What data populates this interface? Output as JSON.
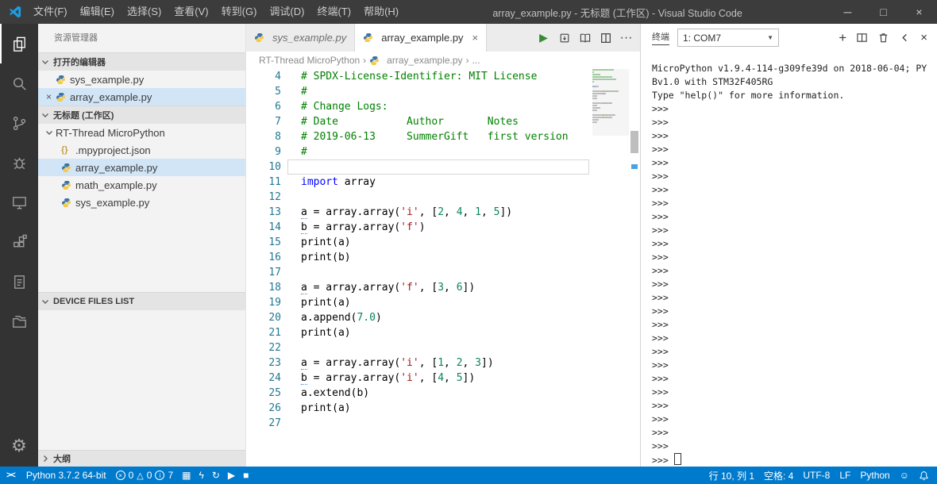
{
  "title_bar": {
    "menus": [
      "文件(F)",
      "编辑(E)",
      "选择(S)",
      "查看(V)",
      "转到(G)",
      "调试(D)",
      "终端(T)",
      "帮助(H)"
    ],
    "title": "array_example.py - 无标题 (工作区) - Visual Studio Code"
  },
  "icons": {
    "minimize": "─",
    "maximize": "□",
    "close": "×",
    "tab_close": "×",
    "dropdown_arrow": "▼",
    "more": "···",
    "plus": "+",
    "breadcrumb_sep": "›",
    "run": "▶",
    "stop": "■",
    "sync": "↻",
    "grid": "▦",
    "flash": "ϟ",
    "warning": "△",
    "smiley": "☺",
    "error_x": "×",
    "info_i": "i",
    "remote": "><"
  },
  "sidebar": {
    "title": "资源管理器",
    "open_editors": {
      "label": "打开的编辑器",
      "items": [
        {
          "name": "sys_example.py",
          "selected": false
        },
        {
          "name": "array_example.py",
          "selected": true
        }
      ]
    },
    "workspace": {
      "label": "无标题 (工作区)",
      "tree": [
        {
          "name": "RT-Thread MicroPython",
          "type": "folder"
        },
        {
          "name": ".mpyproject.json",
          "type": "json"
        },
        {
          "name": "array_example.py",
          "type": "py",
          "selected": true
        },
        {
          "name": "math_example.py",
          "type": "py"
        },
        {
          "name": "sys_example.py",
          "type": "py"
        }
      ]
    },
    "device_files_label": "DEVICE FILES LIST",
    "outline_label": "大纲"
  },
  "editor": {
    "tabs": [
      {
        "label": "sys_example.py",
        "active": false,
        "italic": true
      },
      {
        "label": "array_example.py",
        "active": true,
        "italic": false
      }
    ],
    "breadcrumbs": [
      "RT-Thread MicroPython",
      "array_example.py",
      "..."
    ],
    "current_line": 10,
    "lines": [
      {
        "ln": 4,
        "toks": [
          {
            "c": "c",
            "t": "# SPDX-License-Identifier: MIT License"
          }
        ]
      },
      {
        "ln": 5,
        "toks": [
          {
            "c": "c",
            "t": "#"
          }
        ]
      },
      {
        "ln": 6,
        "toks": [
          {
            "c": "c",
            "t": "# Change Logs:"
          }
        ]
      },
      {
        "ln": 7,
        "toks": [
          {
            "c": "c",
            "t": "# Date           Author       Notes"
          }
        ]
      },
      {
        "ln": 8,
        "toks": [
          {
            "c": "c",
            "t": "# 2019-06-13     SummerGift   first version"
          }
        ]
      },
      {
        "ln": 9,
        "toks": [
          {
            "c": "c",
            "t": "#"
          }
        ]
      },
      {
        "ln": 10,
        "toks": []
      },
      {
        "ln": 11,
        "toks": [
          {
            "c": "k",
            "t": "import"
          },
          {
            "c": "p",
            "t": " array"
          }
        ]
      },
      {
        "ln": 12,
        "toks": []
      },
      {
        "ln": 13,
        "toks": [
          {
            "c": "u",
            "t": "a"
          },
          {
            "c": "p",
            "t": " = array.array("
          },
          {
            "c": "s",
            "t": "'i'"
          },
          {
            "c": "p",
            "t": ", ["
          },
          {
            "c": "n",
            "t": "2"
          },
          {
            "c": "p",
            "t": ", "
          },
          {
            "c": "n",
            "t": "4"
          },
          {
            "c": "p",
            "t": ", "
          },
          {
            "c": "n",
            "t": "1"
          },
          {
            "c": "p",
            "t": ", "
          },
          {
            "c": "n",
            "t": "5"
          },
          {
            "c": "p",
            "t": "])"
          }
        ]
      },
      {
        "ln": 14,
        "toks": [
          {
            "c": "u",
            "t": "b"
          },
          {
            "c": "p",
            "t": " = array.array("
          },
          {
            "c": "s",
            "t": "'f'"
          },
          {
            "c": "p",
            "t": ")"
          }
        ]
      },
      {
        "ln": 15,
        "toks": [
          {
            "c": "p",
            "t": "print(a)"
          }
        ]
      },
      {
        "ln": 16,
        "toks": [
          {
            "c": "p",
            "t": "print(b)"
          }
        ]
      },
      {
        "ln": 17,
        "toks": []
      },
      {
        "ln": 18,
        "toks": [
          {
            "c": "u",
            "t": "a"
          },
          {
            "c": "p",
            "t": " = array.array("
          },
          {
            "c": "s",
            "t": "'f'"
          },
          {
            "c": "p",
            "t": ", ["
          },
          {
            "c": "n",
            "t": "3"
          },
          {
            "c": "p",
            "t": ", "
          },
          {
            "c": "n",
            "t": "6"
          },
          {
            "c": "p",
            "t": "])"
          }
        ]
      },
      {
        "ln": 19,
        "toks": [
          {
            "c": "p",
            "t": "print(a)"
          }
        ]
      },
      {
        "ln": 20,
        "toks": [
          {
            "c": "p",
            "t": "a.append("
          },
          {
            "c": "n",
            "t": "7.0"
          },
          {
            "c": "p",
            "t": ")"
          }
        ]
      },
      {
        "ln": 21,
        "toks": [
          {
            "c": "p",
            "t": "print(a)"
          }
        ]
      },
      {
        "ln": 22,
        "toks": []
      },
      {
        "ln": 23,
        "toks": [
          {
            "c": "u",
            "t": "a"
          },
          {
            "c": "p",
            "t": " = array.array("
          },
          {
            "c": "s",
            "t": "'i'"
          },
          {
            "c": "p",
            "t": ", ["
          },
          {
            "c": "n",
            "t": "1"
          },
          {
            "c": "p",
            "t": ", "
          },
          {
            "c": "n",
            "t": "2"
          },
          {
            "c": "p",
            "t": ", "
          },
          {
            "c": "n",
            "t": "3"
          },
          {
            "c": "p",
            "t": "])"
          }
        ]
      },
      {
        "ln": 24,
        "toks": [
          {
            "c": "u",
            "t": "b"
          },
          {
            "c": "p",
            "t": " = array.array("
          },
          {
            "c": "s",
            "t": "'i'"
          },
          {
            "c": "p",
            "t": ", ["
          },
          {
            "c": "n",
            "t": "4"
          },
          {
            "c": "p",
            "t": ", "
          },
          {
            "c": "n",
            "t": "5"
          },
          {
            "c": "p",
            "t": "])"
          }
        ]
      },
      {
        "ln": 25,
        "toks": [
          {
            "c": "p",
            "t": "a.extend(b)"
          }
        ]
      },
      {
        "ln": 26,
        "toks": [
          {
            "c": "p",
            "t": "print(a)"
          }
        ]
      },
      {
        "ln": 27,
        "toks": []
      }
    ]
  },
  "terminal": {
    "title": "终端",
    "selector": "1: COM7",
    "intro": [
      "MicroPython v1.9.4-114-g309fe39d on 2018-06-04; PY",
      "Bv1.0 with STM32F405RG",
      "Type \"help()\" for more information."
    ],
    "prompt": ">>>",
    "prompt_rows": 26
  },
  "status_bar": {
    "interpreter": "Python 3.7.2 64-bit",
    "errors": "0",
    "warnings": "0",
    "infos": "7",
    "line_col": "行 10, 列 1",
    "indent": "空格: 4",
    "encoding": "UTF-8",
    "eol": "LF",
    "language": "Python"
  },
  "colors": {
    "accent": "#007acc",
    "title_bar": "#3c3c3c",
    "activity_bar": "#333333",
    "sidebar_bg": "#f3f3f3",
    "selection_bg": "#d1e5f7",
    "comment": "#008000",
    "keyword": "#0000ff",
    "string": "#a31515",
    "number": "#098658",
    "run_green": "#388a34"
  }
}
